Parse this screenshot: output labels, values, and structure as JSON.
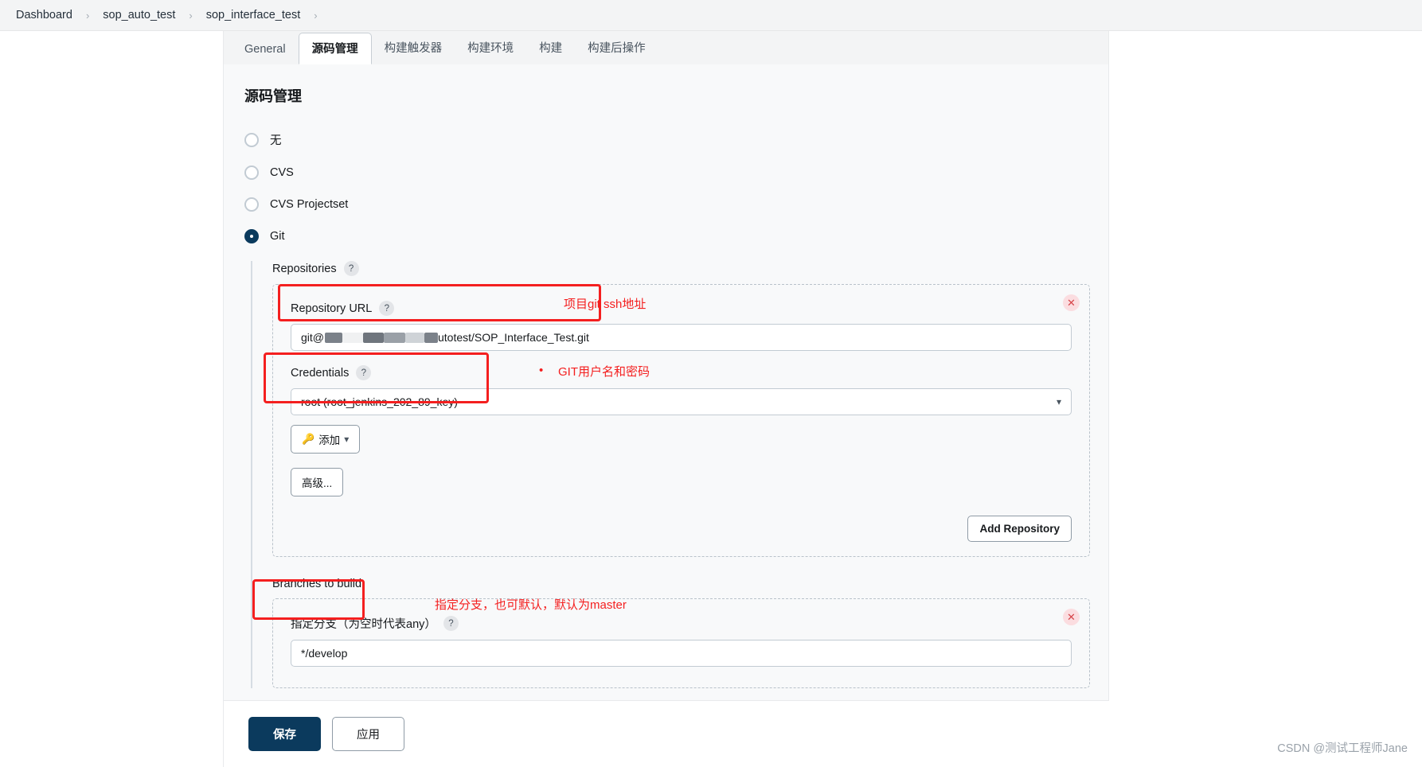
{
  "breadcrumb": {
    "items": [
      {
        "label": "Dashboard"
      },
      {
        "label": "sop_auto_test"
      },
      {
        "label": "sop_interface_test"
      }
    ],
    "separator": "›"
  },
  "tabs": [
    {
      "label": "General",
      "active": false
    },
    {
      "label": "源码管理",
      "active": true
    },
    {
      "label": "构建触发器",
      "active": false
    },
    {
      "label": "构建环境",
      "active": false
    },
    {
      "label": "构建",
      "active": false
    },
    {
      "label": "构建后操作",
      "active": false
    }
  ],
  "section": {
    "title": "源码管理",
    "scm_options": [
      {
        "label": "无",
        "checked": false
      },
      {
        "label": "CVS",
        "checked": false
      },
      {
        "label": "CVS Projectset",
        "checked": false
      },
      {
        "label": "Git",
        "checked": true
      }
    ]
  },
  "git": {
    "repositories_label": "Repositories",
    "help_glyph": "?",
    "close_glyph": "✕",
    "repo": {
      "url_label": "Repository URL",
      "url_value_prefix": "git@",
      "url_value_suffix": "utotest/SOP_Interface_Test.git",
      "credentials_label": "Credentials",
      "credentials_value": "root (root_jenkins_202_89_key)",
      "credentials_caret": "▾",
      "add_credentials_label": "添加",
      "add_credentials_caret": "▾",
      "key_icon_glyph": "🔑",
      "advanced_label": "高级...",
      "add_repository_label": "Add Repository"
    },
    "branches": {
      "label": "Branches to build",
      "specifier_label": "指定分支（为空时代表any）",
      "specifier_value": "*/develop"
    }
  },
  "annotations": {
    "accent_color": "#f41f1f",
    "url_note": "项目git ssh地址",
    "credentials_note": "GIT用户名和密码",
    "credentials_bullet": "•",
    "branch_note": "指定分支，也可默认，默认为master"
  },
  "footer": {
    "save_label": "保存",
    "apply_label": "应用"
  },
  "watermark": "CSDN @测试工程师Jane"
}
